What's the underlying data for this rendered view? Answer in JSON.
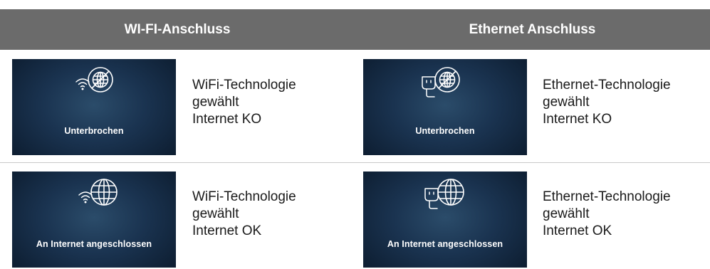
{
  "header": {
    "left": "WI-FI-Anschluss",
    "right": "Ethernet Anschluss"
  },
  "rows": [
    {
      "left": {
        "icon": "wifi-icon",
        "globe": "globe-crossed-icon",
        "screen_label": "Unterbrochen",
        "desc": [
          "WiFi-Technologie",
          "gewählt",
          "Internet KO"
        ]
      },
      "right": {
        "icon": "ethernet-plug-icon",
        "globe": "globe-crossed-icon",
        "screen_label": "Unterbrochen",
        "desc": [
          "Ethernet-Technologie",
          "gewählt",
          "Internet KO"
        ]
      }
    },
    {
      "left": {
        "icon": "wifi-icon",
        "globe": "globe-icon",
        "screen_label": "An Internet angeschlossen",
        "desc": [
          "WiFi-Technologie",
          "gewählt",
          "Internet OK"
        ]
      },
      "right": {
        "icon": "ethernet-plug-icon",
        "globe": "globe-icon",
        "screen_label": "An Internet angeschlossen",
        "desc": [
          "Ethernet-Technologie",
          "gewählt",
          "Internet OK"
        ]
      }
    }
  ]
}
